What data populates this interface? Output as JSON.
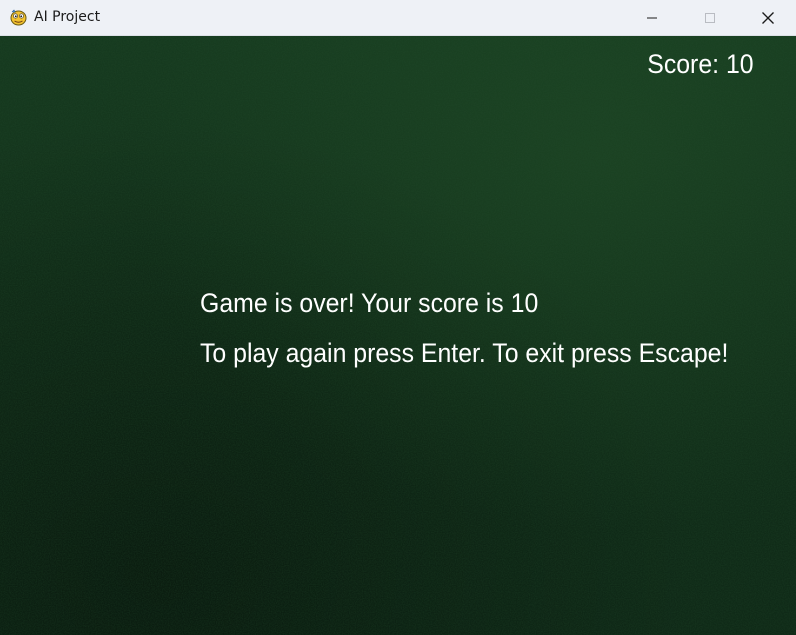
{
  "window": {
    "title": "AI Project",
    "app_icon": "pygame-snake-icon",
    "controls": {
      "minimize_icon": "minimize-icon",
      "maximize_icon": "maximize-icon",
      "close_icon": "close-icon"
    }
  },
  "game": {
    "score_label": "Score: 10",
    "score": 10,
    "game_over_message": "Game is over! Your score is 10",
    "instructions": "To play again press Enter. To exit press Escape!",
    "background_color": "#133320",
    "text_color": "#ffffff"
  }
}
